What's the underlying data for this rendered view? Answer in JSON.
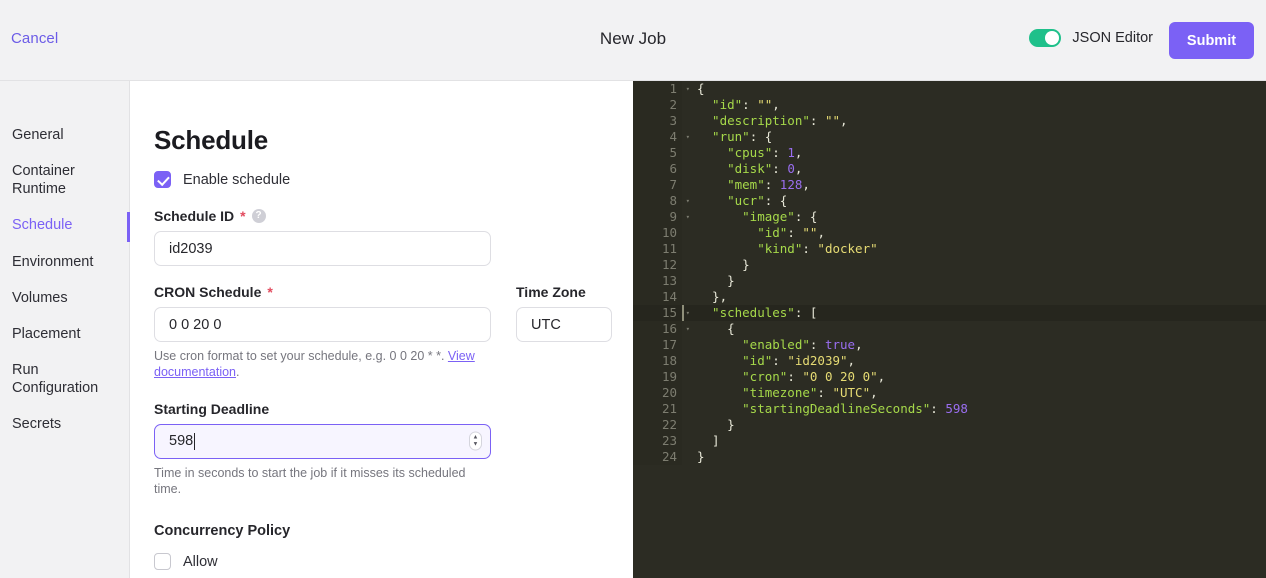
{
  "header": {
    "cancel_label": "Cancel",
    "title": "New Job",
    "toggle_label": "JSON Editor",
    "toggle_state": "on",
    "submit_label": "Submit",
    "accent_color": "#7b61f5",
    "toggle_on_color": "#1fc08a"
  },
  "sidebar": {
    "items": [
      {
        "label": "General",
        "active": false
      },
      {
        "label": "Container Runtime",
        "active": false
      },
      {
        "label": "Schedule",
        "active": true
      },
      {
        "label": "Environment",
        "active": false
      },
      {
        "label": "Volumes",
        "active": false
      },
      {
        "label": "Placement",
        "active": false
      },
      {
        "label": "Run Configuration",
        "active": false
      },
      {
        "label": "Secrets",
        "active": false
      }
    ]
  },
  "form": {
    "title": "Schedule",
    "enable_schedule": {
      "label": "Enable schedule",
      "checked": true
    },
    "schedule_id": {
      "label": "Schedule ID",
      "required_marker": "*",
      "help_icon_glyph": "?",
      "value": "id2039"
    },
    "cron_schedule": {
      "label": "CRON Schedule",
      "required_marker": "*",
      "value": "0 0 20 0",
      "helper_prefix": "Use cron format to set your schedule, e.g. 0 0 20 * *. ",
      "helper_link": "View documentation",
      "helper_suffix": "."
    },
    "time_zone": {
      "label": "Time Zone",
      "value": "UTC"
    },
    "starting_deadline": {
      "label": "Starting Deadline",
      "value": "598",
      "focused": true,
      "helper": "Time in seconds to start the job if it misses its scheduled time.",
      "spinner_up": "▲",
      "spinner_down": "▼"
    },
    "concurrency_policy": {
      "label": "Concurrency Policy",
      "allow": {
        "label": "Allow",
        "checked": false
      }
    }
  },
  "editor": {
    "active_line": 15,
    "lines": [
      {
        "num": "1",
        "fold": true,
        "tokens": [
          {
            "t": "{",
            "c": "p"
          }
        ]
      },
      {
        "num": "2",
        "fold": false,
        "tokens": [
          {
            "t": "  \"id\"",
            "c": "k"
          },
          {
            "t": ": ",
            "c": "p"
          },
          {
            "t": "\"\"",
            "c": "s"
          },
          {
            "t": ",",
            "c": "p"
          }
        ]
      },
      {
        "num": "3",
        "fold": false,
        "tokens": [
          {
            "t": "  \"description\"",
            "c": "k"
          },
          {
            "t": ": ",
            "c": "p"
          },
          {
            "t": "\"\"",
            "c": "s"
          },
          {
            "t": ",",
            "c": "p"
          }
        ]
      },
      {
        "num": "4",
        "fold": true,
        "tokens": [
          {
            "t": "  \"run\"",
            "c": "k"
          },
          {
            "t": ": {",
            "c": "p"
          }
        ]
      },
      {
        "num": "5",
        "fold": false,
        "tokens": [
          {
            "t": "    \"cpus\"",
            "c": "k"
          },
          {
            "t": ": ",
            "c": "p"
          },
          {
            "t": "1",
            "c": "n"
          },
          {
            "t": ",",
            "c": "p"
          }
        ]
      },
      {
        "num": "6",
        "fold": false,
        "tokens": [
          {
            "t": "    \"disk\"",
            "c": "k"
          },
          {
            "t": ": ",
            "c": "p"
          },
          {
            "t": "0",
            "c": "n"
          },
          {
            "t": ",",
            "c": "p"
          }
        ]
      },
      {
        "num": "7",
        "fold": false,
        "tokens": [
          {
            "t": "    \"mem\"",
            "c": "k"
          },
          {
            "t": ": ",
            "c": "p"
          },
          {
            "t": "128",
            "c": "n"
          },
          {
            "t": ",",
            "c": "p"
          }
        ]
      },
      {
        "num": "8",
        "fold": true,
        "tokens": [
          {
            "t": "    \"ucr\"",
            "c": "k"
          },
          {
            "t": ": {",
            "c": "p"
          }
        ]
      },
      {
        "num": "9",
        "fold": true,
        "tokens": [
          {
            "t": "      \"image\"",
            "c": "k"
          },
          {
            "t": ": {",
            "c": "p"
          }
        ]
      },
      {
        "num": "10",
        "fold": false,
        "tokens": [
          {
            "t": "        \"id\"",
            "c": "k"
          },
          {
            "t": ": ",
            "c": "p"
          },
          {
            "t": "\"\"",
            "c": "s"
          },
          {
            "t": ",",
            "c": "p"
          }
        ]
      },
      {
        "num": "11",
        "fold": false,
        "tokens": [
          {
            "t": "        \"kind\"",
            "c": "k"
          },
          {
            "t": ": ",
            "c": "p"
          },
          {
            "t": "\"docker\"",
            "c": "s"
          }
        ]
      },
      {
        "num": "12",
        "fold": false,
        "tokens": [
          {
            "t": "      }",
            "c": "p"
          }
        ]
      },
      {
        "num": "13",
        "fold": false,
        "tokens": [
          {
            "t": "    }",
            "c": "p"
          }
        ]
      },
      {
        "num": "14",
        "fold": false,
        "tokens": [
          {
            "t": "  },",
            "c": "p"
          }
        ]
      },
      {
        "num": "15",
        "fold": true,
        "tokens": [
          {
            "t": "  \"schedules\"",
            "c": "k"
          },
          {
            "t": ": [",
            "c": "p"
          }
        ]
      },
      {
        "num": "16",
        "fold": true,
        "tokens": [
          {
            "t": "    {",
            "c": "p"
          }
        ]
      },
      {
        "num": "17",
        "fold": false,
        "tokens": [
          {
            "t": "      \"enabled\"",
            "c": "k"
          },
          {
            "t": ": ",
            "c": "p"
          },
          {
            "t": "true",
            "c": "b"
          },
          {
            "t": ",",
            "c": "p"
          }
        ]
      },
      {
        "num": "18",
        "fold": false,
        "tokens": [
          {
            "t": "      \"id\"",
            "c": "k"
          },
          {
            "t": ": ",
            "c": "p"
          },
          {
            "t": "\"id2039\"",
            "c": "s"
          },
          {
            "t": ",",
            "c": "p"
          }
        ]
      },
      {
        "num": "19",
        "fold": false,
        "tokens": [
          {
            "t": "      \"cron\"",
            "c": "k"
          },
          {
            "t": ": ",
            "c": "p"
          },
          {
            "t": "\"0 0 20 0\"",
            "c": "s"
          },
          {
            "t": ",",
            "c": "p"
          }
        ]
      },
      {
        "num": "20",
        "fold": false,
        "tokens": [
          {
            "t": "      \"timezone\"",
            "c": "k"
          },
          {
            "t": ": ",
            "c": "p"
          },
          {
            "t": "\"UTC\"",
            "c": "s"
          },
          {
            "t": ",",
            "c": "p"
          }
        ]
      },
      {
        "num": "21",
        "fold": false,
        "tokens": [
          {
            "t": "      \"startingDeadlineSeconds\"",
            "c": "k"
          },
          {
            "t": ": ",
            "c": "p"
          },
          {
            "t": "598",
            "c": "n"
          }
        ]
      },
      {
        "num": "22",
        "fold": false,
        "tokens": [
          {
            "t": "    }",
            "c": "p"
          }
        ]
      },
      {
        "num": "23",
        "fold": false,
        "tokens": [
          {
            "t": "  ]",
            "c": "p"
          }
        ]
      },
      {
        "num": "24",
        "fold": false,
        "tokens": [
          {
            "t": "}",
            "c": "p"
          }
        ]
      }
    ]
  }
}
